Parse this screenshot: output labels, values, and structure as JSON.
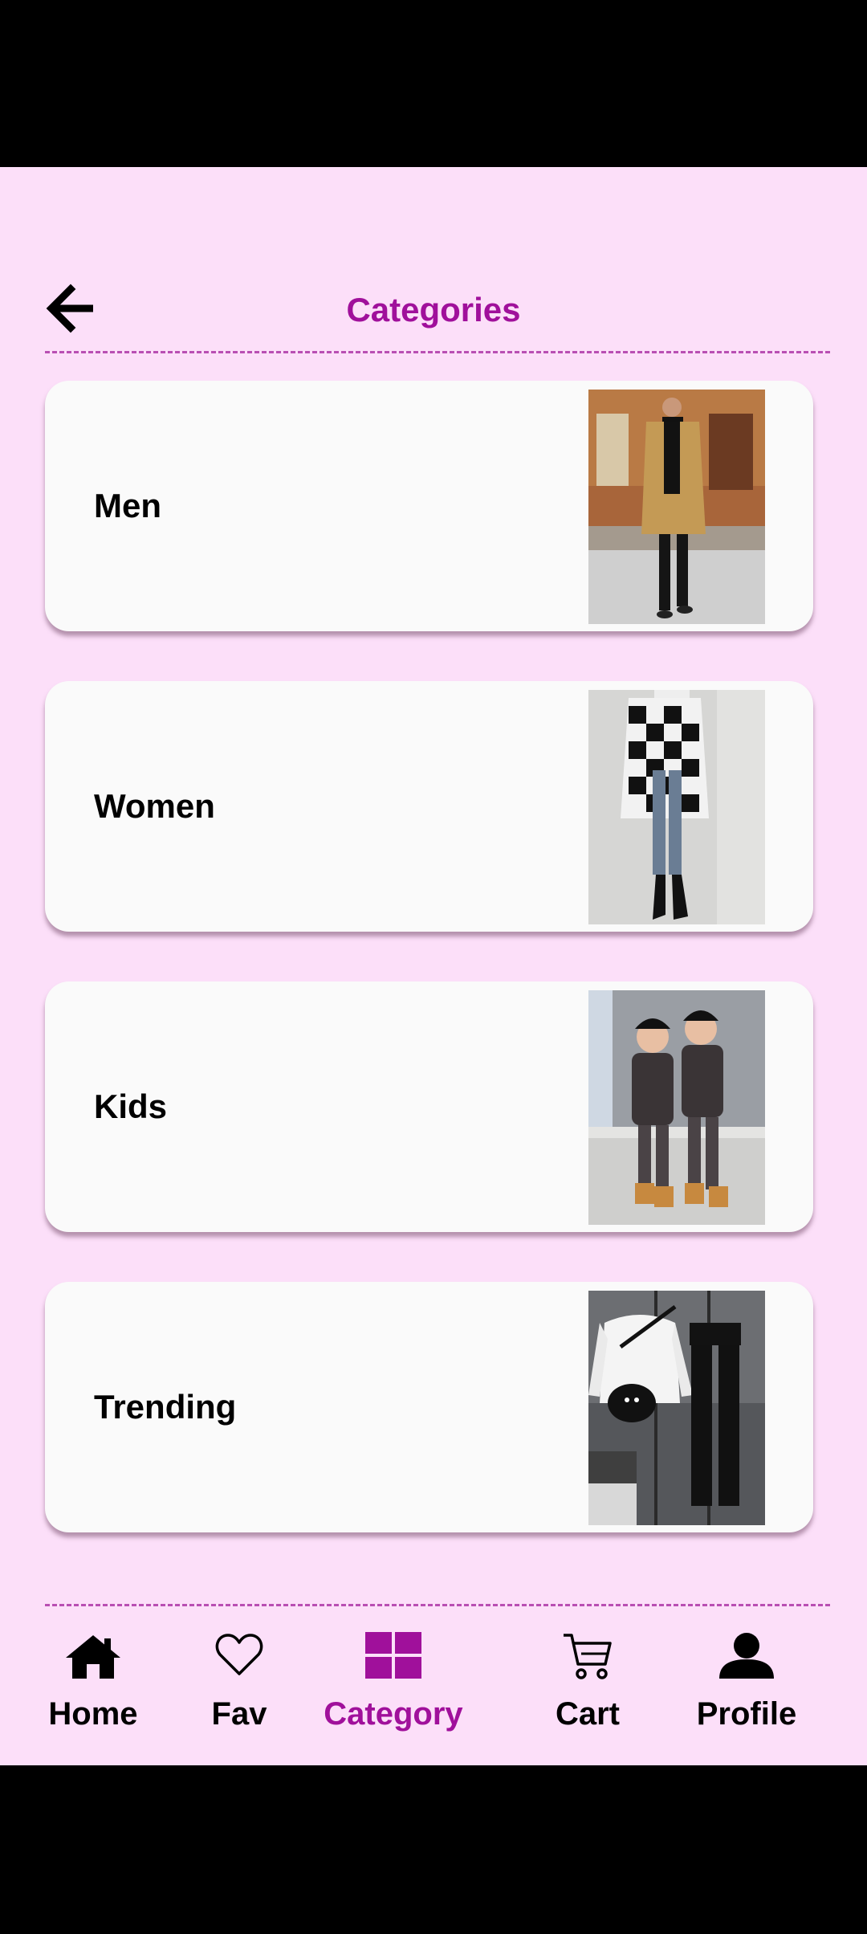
{
  "header": {
    "title": "Categories",
    "back_icon": "arrow-left-icon"
  },
  "categories": [
    {
      "label": "Men"
    },
    {
      "label": "Women"
    },
    {
      "label": "Kids"
    },
    {
      "label": "Trending"
    }
  ],
  "bottom_nav": {
    "items": [
      {
        "label": "Home",
        "icon": "home-icon",
        "active": false
      },
      {
        "label": "Fav",
        "icon": "heart-icon",
        "active": false
      },
      {
        "label": "Category",
        "icon": "grid-icon",
        "active": true
      },
      {
        "label": "Cart",
        "icon": "cart-icon",
        "active": false
      },
      {
        "label": "Profile",
        "icon": "person-icon",
        "active": false
      }
    ]
  },
  "colors": {
    "background": "#fcdff9",
    "accent": "#a0109b",
    "card": "#fafafa"
  }
}
